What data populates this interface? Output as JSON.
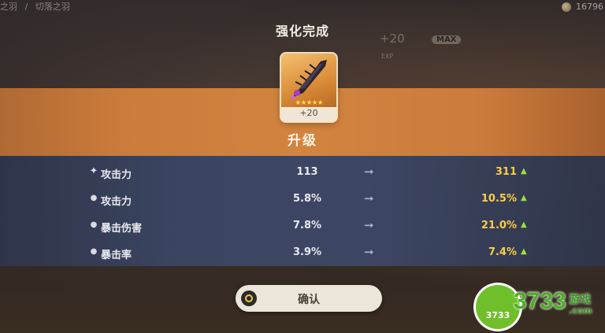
{
  "breadcrumb": [
    "之羽",
    "切落之羽"
  ],
  "currency": {
    "amount": "16796",
    "icon": "coin-icon"
  },
  "title": "强化完成",
  "background_panel": {
    "level": "+20",
    "max": "MAX",
    "exp": "EXP"
  },
  "item": {
    "stars": "★★★★★",
    "level": "+20"
  },
  "banner": {
    "label": "升级"
  },
  "stats": [
    {
      "name": "攻击力",
      "old": "113",
      "new": "311",
      "bullet": "✦"
    },
    {
      "name": "攻击力",
      "old": "5.8%",
      "new": "10.5%",
      "bullet": "●"
    },
    {
      "name": "暴击伤害",
      "old": "7.8%",
      "new": "21.0%",
      "bullet": "●"
    },
    {
      "name": "暴击率",
      "old": "3.9%",
      "new": "7.4%",
      "bullet": "●"
    }
  ],
  "arrow_glyph": "➞",
  "up_glyph": "▲",
  "confirm": {
    "label": "确认"
  },
  "watermark": {
    "badge": "3733",
    "big": "3733",
    "cn": "游戏",
    "com": ".com"
  },
  "colors": {
    "accent_orange": "#d3843f",
    "new_value": "#ffcd4a",
    "up_arrow": "#9be23d",
    "stats_bg": "#3b4561"
  }
}
